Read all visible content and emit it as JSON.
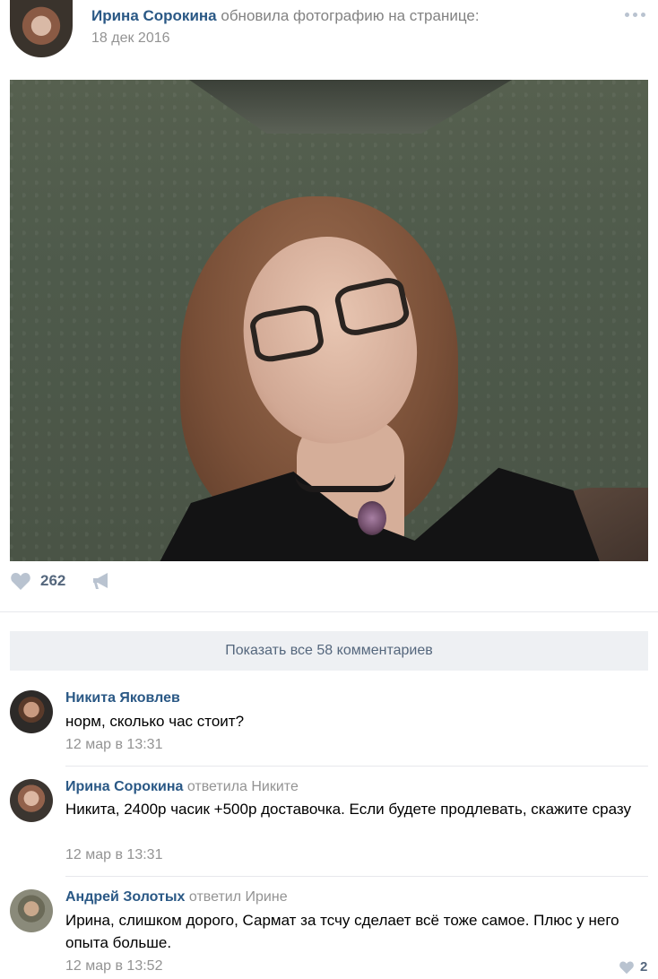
{
  "post": {
    "author": "Ирина Сорокина",
    "action": "обновила фотографию на странице:",
    "date": "18 дек 2016",
    "likes": "262"
  },
  "comments_bar": {
    "show_all_label": "Показать все 58 комментариев"
  },
  "comments": [
    {
      "author": "Никита Яковлев",
      "reply_to": "",
      "text": "норм, сколько час стоит?",
      "date": "12 мар в 13:31",
      "likes": ""
    },
    {
      "author": "Ирина Сорокина",
      "reply_to": "ответила Никите",
      "text": "Никита, 2400р часик +500р доставочка. Если будете продлевать, скажите сразу",
      "date": "12 мар в 13:31",
      "likes": ""
    },
    {
      "author": "Андрей Золотых",
      "reply_to": "ответил Ирине",
      "text": "Ирина, слишком дорого, Сармат за тсчу сделает всё тоже самое. Плюс у него опыта больше.",
      "date": "12 мар в 13:52",
      "likes": "2"
    }
  ],
  "colors": {
    "link": "#2a5885",
    "muted": "#939393",
    "icon": "#b9c3d0",
    "button_bg": "#eef0f3"
  },
  "icons": {
    "like": "heart-icon",
    "share": "megaphone-icon",
    "more": "more-dots-icon"
  }
}
